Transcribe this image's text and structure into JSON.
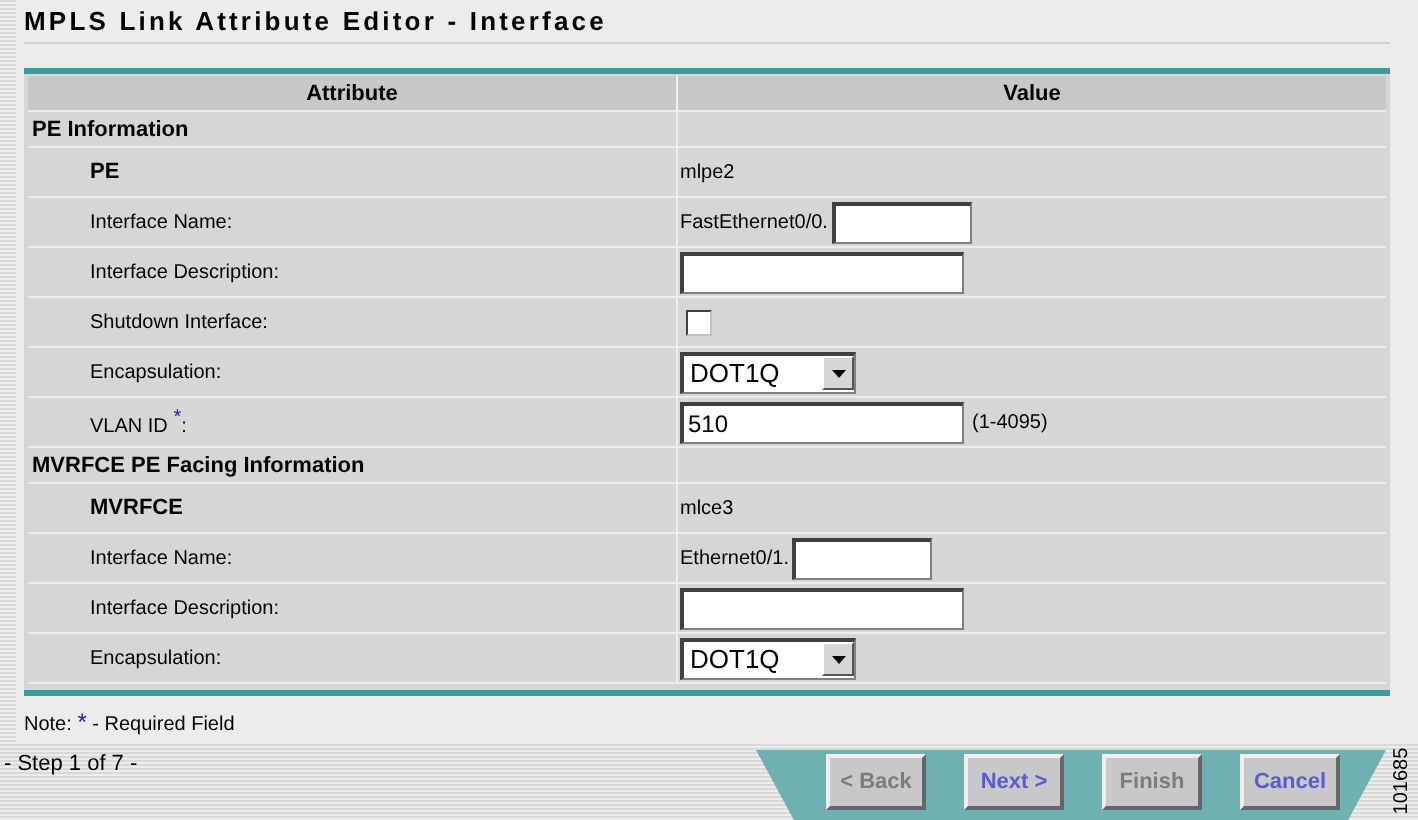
{
  "title": "MPLS Link Attribute Editor - Interface",
  "columns": [
    "Attribute",
    "Value"
  ],
  "sections": [
    {
      "title": "PE Information",
      "rows": [
        {
          "kind": "header",
          "label": "PE",
          "value": "mlpe2"
        },
        {
          "kind": "prefixed-input",
          "label": "Interface Name:",
          "prefix": "FastEthernet0/0."
        },
        {
          "kind": "input",
          "label": "Interface Description:"
        },
        {
          "kind": "checkbox",
          "label": "Shutdown Interface:",
          "checked": false
        },
        {
          "kind": "select",
          "label": "Encapsulation:",
          "value": "DOT1Q"
        },
        {
          "kind": "input",
          "label": "VLAN ID",
          "required_mark": "*",
          "label_suffix": ":",
          "value": "510",
          "hint": "(1-4095)"
        }
      ]
    },
    {
      "title": "MVRFCE PE Facing Information",
      "rows": [
        {
          "kind": "header",
          "label": "MVRFCE",
          "value": "mlce3"
        },
        {
          "kind": "prefixed-input",
          "label": "Interface Name:",
          "prefix": "Ethernet0/1."
        },
        {
          "kind": "input",
          "label": "Interface Description:"
        },
        {
          "kind": "select",
          "label": "Encapsulation:",
          "value": "DOT1Q"
        }
      ]
    }
  ],
  "note": {
    "prefix": "Note:",
    "mark": "*",
    "text": "- Required Field"
  },
  "step": "- Step 1 of 7 -",
  "buttons": [
    {
      "label": "< Back",
      "disabled": true
    },
    {
      "label": "Next >",
      "disabled": false
    },
    {
      "label": "Finish",
      "disabled": true
    },
    {
      "label": "Cancel",
      "disabled": false
    }
  ],
  "figure_number": "101685"
}
